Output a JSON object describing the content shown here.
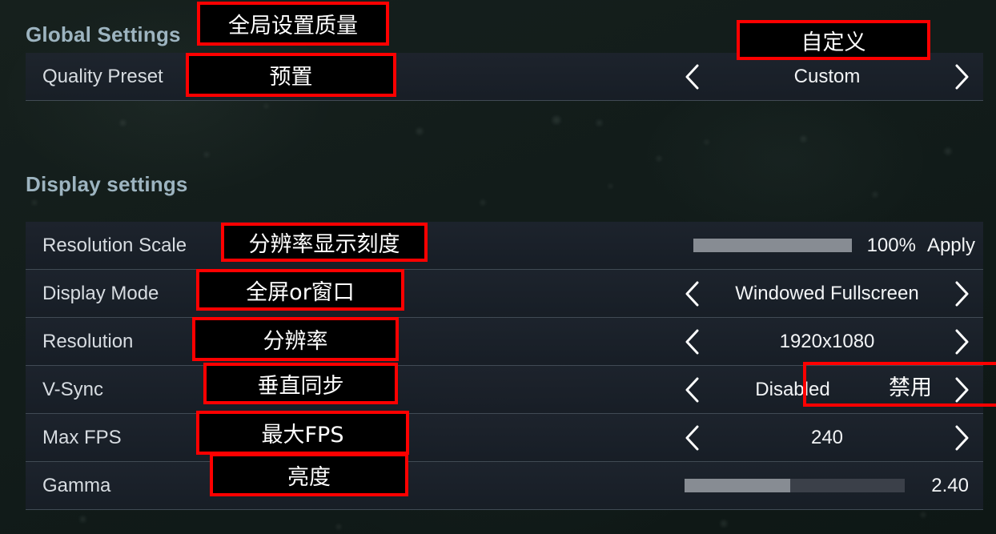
{
  "sections": [
    {
      "id": "global",
      "title": "Global Settings"
    },
    {
      "id": "display",
      "title": "Display settings"
    }
  ],
  "rows": [
    {
      "id": "quality-preset",
      "label": "Quality Preset",
      "control": "stepper",
      "value": "Custom",
      "prev_icon": "chevron-left-icon",
      "next_icon": "chevron-right-icon"
    },
    {
      "id": "resolution-scale",
      "label": "Resolution Scale",
      "control": "slider-apply",
      "value": "100%",
      "apply_label": "Apply",
      "fill_percent": 100
    },
    {
      "id": "display-mode",
      "label": "Display Mode",
      "control": "stepper",
      "value": "Windowed Fullscreen",
      "prev_icon": "chevron-left-icon",
      "next_icon": "chevron-right-icon"
    },
    {
      "id": "resolution",
      "label": "Resolution",
      "control": "stepper",
      "value": "1920x1080",
      "prev_icon": "chevron-left-icon",
      "next_icon": "chevron-right-icon"
    },
    {
      "id": "v-sync",
      "label": "V-Sync",
      "control": "stepper",
      "value": "Disabled",
      "prev_icon": "chevron-left-icon",
      "next_icon": "chevron-right-icon"
    },
    {
      "id": "max-fps",
      "label": "Max FPS",
      "control": "stepper",
      "value": "240",
      "prev_icon": "chevron-left-icon",
      "next_icon": "chevron-right-icon"
    },
    {
      "id": "gamma",
      "label": "Gamma",
      "control": "slider",
      "value": "2.40",
      "fill_percent": 48
    }
  ],
  "annotations": [
    {
      "id": "global-settings-quality",
      "text": "全局设置质量"
    },
    {
      "id": "quality-preset-cn",
      "text": "预置"
    },
    {
      "id": "custom-cn",
      "text": "自定义"
    },
    {
      "id": "resolution-scale-cn",
      "text": "分辨率显示刻度"
    },
    {
      "id": "display-mode-cn",
      "text": "全屏or窗口"
    },
    {
      "id": "resolution-cn",
      "text": "分辨率"
    },
    {
      "id": "vsync-cn",
      "text": "垂直同步"
    },
    {
      "id": "vsync-value-cn",
      "text": "禁用"
    },
    {
      "id": "max-fps-cn",
      "text": "最大FPS"
    },
    {
      "id": "gamma-cn",
      "text": "亮度"
    }
  ],
  "colors": {
    "annotation_border": "#ff0000",
    "section_heading": "#9db4c0",
    "row_background": "#1e242e",
    "slider_fill": "#878c93",
    "slider_track": "#3b4049",
    "text": "#f2f4f6"
  }
}
